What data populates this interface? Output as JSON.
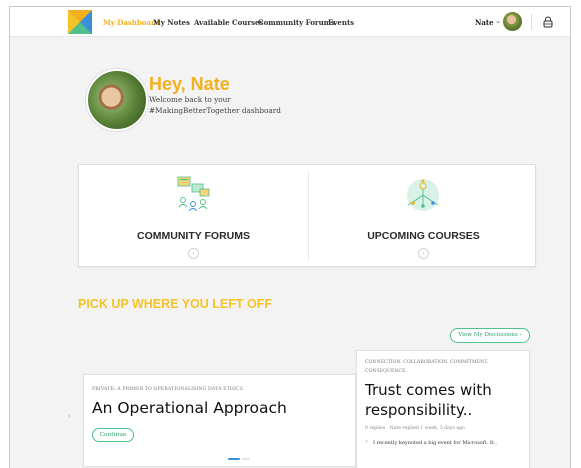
{
  "nav": {
    "items": [
      "My Dashboard",
      "My Notes",
      "Available Courses",
      "Community Forums",
      "Events"
    ],
    "user_name": "Nate",
    "user_caret": "⌄",
    "logo_colors": [
      "#f2b01e",
      "#3b8fd8",
      "#4ec08c"
    ]
  },
  "hero": {
    "greeting": "Hey, Nate",
    "subtitle": "Welcome back to your #MakingBetterTogether dashboard"
  },
  "features": [
    {
      "label": "COMMUNITY FORUMS",
      "icon": "community-forums-icon",
      "arrow": "›"
    },
    {
      "label": "UPCOMING COURSES",
      "icon": "upcoming-courses-icon",
      "arrow": "›"
    }
  ],
  "resume": {
    "title": "PICK UP WHERE YOU LEFT OFF",
    "view_button": "View My Discussions ›",
    "course": {
      "kicker": "PRIVATE: A PRIMER TO OPERATIONALISING DATA ETHICS",
      "title": "An Operational Approach",
      "continue_label": "Continue"
    },
    "carousel_prev": "‹",
    "carousel_next": "›",
    "post": {
      "tags": "CONNECTION. COLLABORATION. COMMITMENT. CONSEQUENCE.",
      "title": "Trust comes with responsibility..",
      "meta": "0 replies · Nate replied 1 week, 3 days ago",
      "snippet_icon": "⌕",
      "snippet": "I recently keynoted a big event for Microsoft. It.."
    }
  },
  "colors": {
    "accent": "#f2b01e",
    "green": "#4ec08c",
    "blue": "#3b8fd8"
  }
}
